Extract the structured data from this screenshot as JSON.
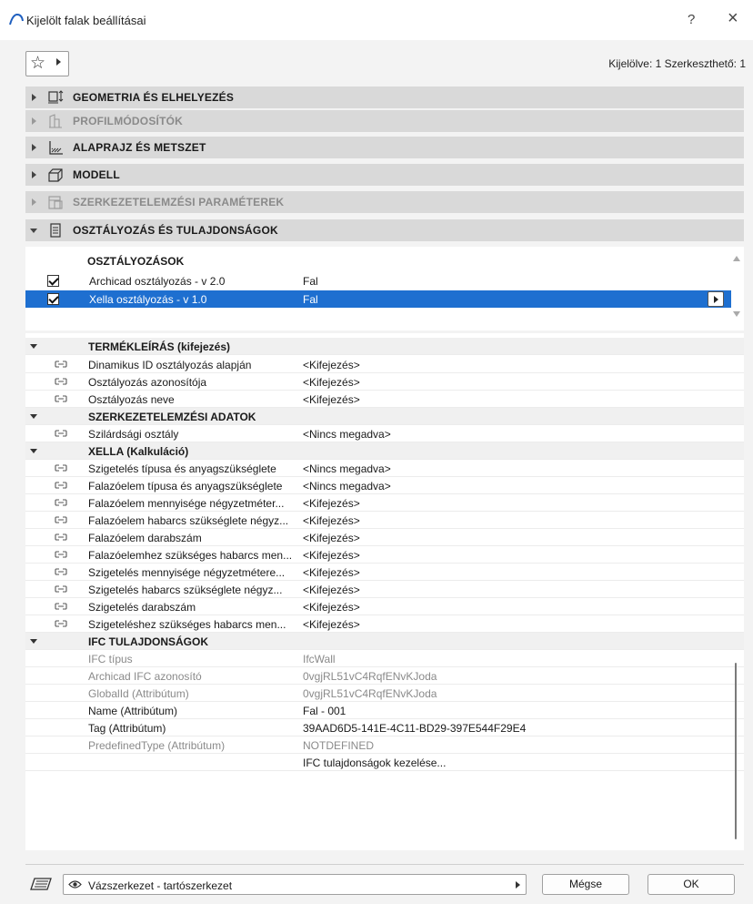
{
  "window": {
    "title": "Kijelölt falak beállításai",
    "help": "?",
    "close": "×"
  },
  "toolbar": {
    "selection_info": "Kijelölve: 1 Szerkeszthető: 1"
  },
  "panels": [
    {
      "label": "GEOMETRIA ÉS ELHELYEZÉS",
      "icon": "geometry-icon"
    },
    {
      "label": "PROFILMÓDOSÍTÓK",
      "icon": "profile-icon"
    },
    {
      "label": "ALAPRAJZ ÉS METSZET",
      "icon": "floorplan-icon"
    },
    {
      "label": "MODELL",
      "icon": "model-icon"
    },
    {
      "label": "SZERKEZETELEMZÉSI PARAMÉTEREK",
      "icon": "structural-icon"
    },
    {
      "label": "OSZTÁLYOZÁS ÉS TULAJDONSÁGOK",
      "icon": "classification-icon"
    }
  ],
  "classifications": {
    "header": "OSZTÁLYOZÁSOK",
    "rows": [
      {
        "name": "Archicad osztályozás - v 2.0",
        "value": "Fal"
      },
      {
        "name": "Xella osztályozás - v 1.0",
        "value": "Fal"
      }
    ]
  },
  "properties": {
    "group1": {
      "title": "TERMÉKLEÍRÁS (kifejezés)",
      "rows": [
        {
          "name": "Dinamikus ID osztályozás alapján",
          "value": "<Kifejezés>"
        },
        {
          "name": "Osztályozás azonosítója",
          "value": "<Kifejezés>"
        },
        {
          "name": "Osztályozás neve",
          "value": "<Kifejezés>"
        }
      ]
    },
    "group2": {
      "title": "SZERKEZETELEMZÉSI ADATOK",
      "rows": [
        {
          "name": "Szilárdsági osztály",
          "value": "<Nincs megadva>"
        }
      ]
    },
    "group3": {
      "title": "XELLA (Kalkuláció)",
      "rows": [
        {
          "name": "Szigetelés típusa és anyagszükséglete",
          "value": "<Nincs megadva>"
        },
        {
          "name": "Falazóelem típusa és anyagszükséglete",
          "value": "<Nincs megadva>"
        },
        {
          "name": "Falazóelem mennyisége négyzetméter...",
          "value": "<Kifejezés>"
        },
        {
          "name": "Falazóelem habarcs szükséglete négyz...",
          "value": "<Kifejezés>"
        },
        {
          "name": "Falazóelem darabszám",
          "value": "<Kifejezés>"
        },
        {
          "name": "Falazóelemhez szükséges habarcs men...",
          "value": "<Kifejezés>"
        },
        {
          "name": "Szigetelés mennyisége négyzetmétere...",
          "value": "<Kifejezés>"
        },
        {
          "name": "Szigetelés  habarcs szükséglete négyz...",
          "value": "<Kifejezés>"
        },
        {
          "name": "Szigetelés darabszám",
          "value": "<Kifejezés>"
        },
        {
          "name": "Szigeteléshez szükséges habarcs men...",
          "value": "<Kifejezés>"
        }
      ]
    },
    "group4": {
      "title": "IFC TULAJDONSÁGOK",
      "rows": [
        {
          "name": "IFC típus",
          "value": "IfcWall"
        },
        {
          "name": "Archicad IFC azonosító",
          "value": "0vgjRL51vC4RqfENvKJoda"
        },
        {
          "name": "GlobalId (Attribútum)",
          "value": "0vgjRL51vC4RqfENvKJoda"
        },
        {
          "name": "Name (Attribútum)",
          "value": "Fal - 001"
        },
        {
          "name": "Tag (Attribútum)",
          "value": "39AAD6D5-141E-4C11-BD29-397E544F29E4"
        },
        {
          "name": "PredefinedType (Attribútum)",
          "value": "NOTDEFINED"
        },
        {
          "name": "",
          "value": "IFC tulajdonságok kezelése..."
        }
      ]
    }
  },
  "footer": {
    "layer": "Vázszerkezet - tartószerkezet",
    "cancel": "Mégse",
    "ok": "OK"
  },
  "colors": {
    "selection": "#1e6fd0",
    "panel_header": "#d9d9d9",
    "group_row": "#f0f0f0"
  }
}
